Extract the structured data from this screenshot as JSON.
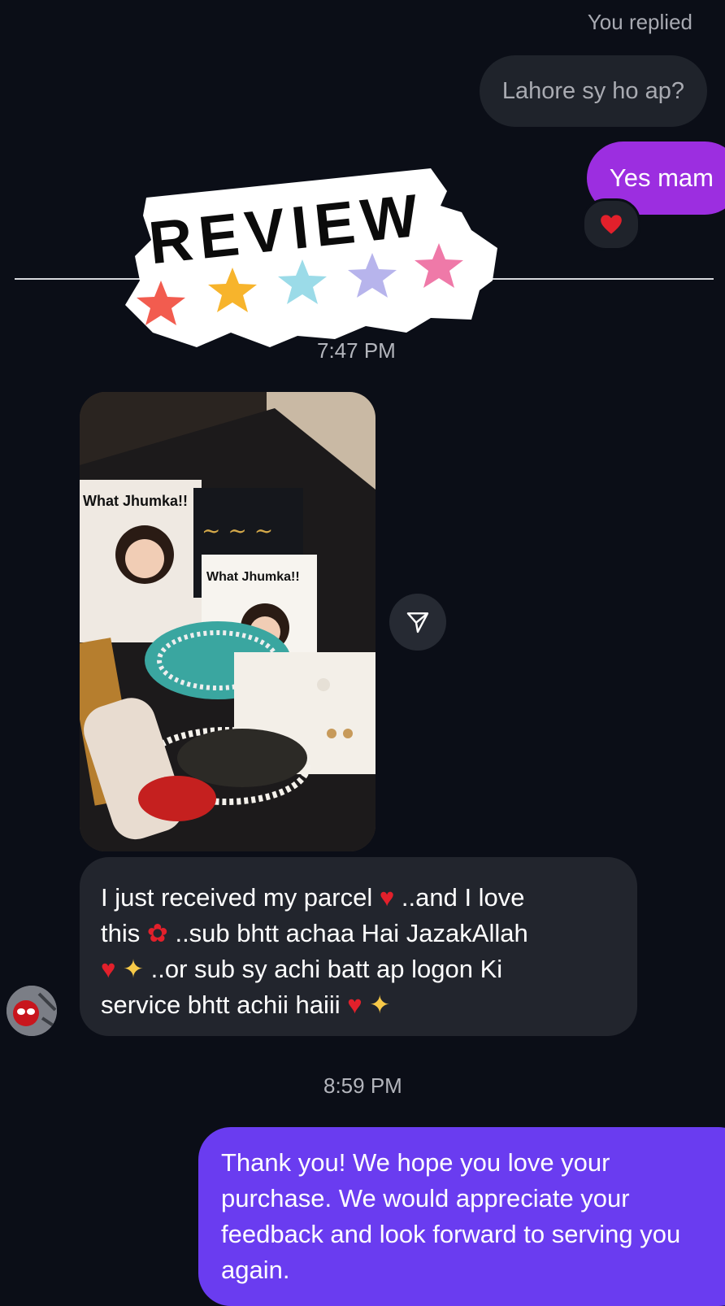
{
  "thread": {
    "reply_label": "You replied",
    "replied_message": "Lahore sy ho ap?",
    "sent_short": "Yes mam",
    "reaction_icon": "heart-icon"
  },
  "sticker": {
    "text": "REVIEW",
    "star_colors": [
      "#f25c4f",
      "#f7b42c",
      "#9bdbe8",
      "#b7b4ec",
      "#ef79a8"
    ]
  },
  "timestamps": [
    "7:47 PM",
    "8:59 PM"
  ],
  "photo_cards": {
    "card1": "What Jhumka!!",
    "card2": "What Jhumka!!"
  },
  "received_message": {
    "line1_a": "I just received my parcel ",
    "line1_b": " ..and I love",
    "line2_a": "this ",
    "line2_b": " ..sub bhtt achaa Hai JazakAllah",
    "line3": " ..or sub sy achi batt ap logon Ki",
    "line4": "service bhtt achii haiii "
  },
  "sent_message": {
    "text": "Thank you! We hope you love your purchase. We would appreciate your feedback and look forward to serving you again."
  },
  "colors": {
    "background": "#0b0e17",
    "bubble_received": "#22252d",
    "bubble_sent_purple": "#9c2ee0",
    "bubble_sent_blue": "#6a3cf0"
  }
}
